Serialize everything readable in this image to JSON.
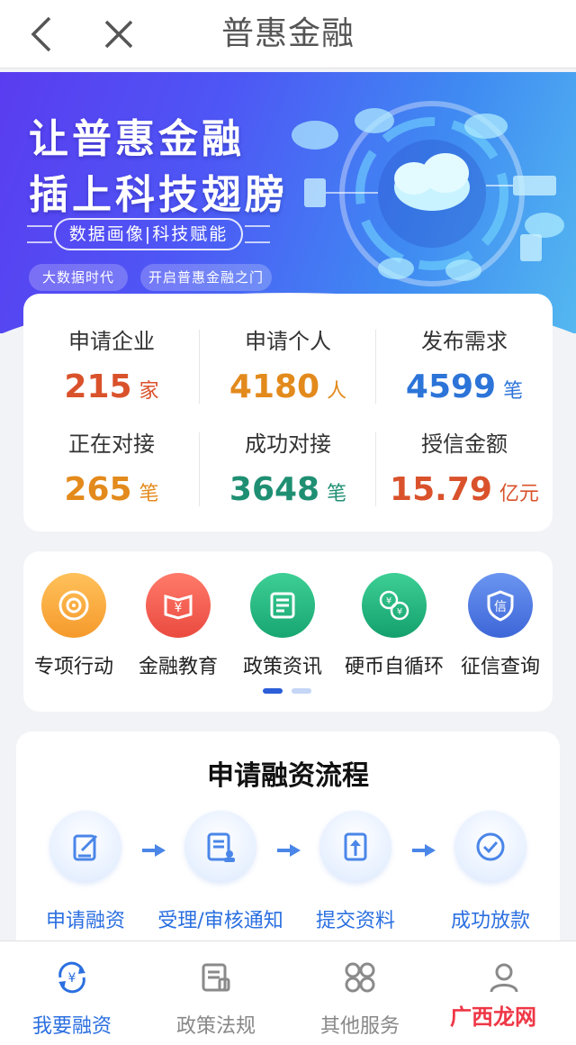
{
  "header": {
    "title": "普惠金融",
    "back_icon": "back-arrow-icon",
    "close_icon": "close-icon"
  },
  "banner": {
    "line1": "让普惠金融",
    "line2": "插上科技翅膀",
    "tagline": "数据画像|科技赋能",
    "pills": [
      "大数据时代",
      "开启普惠金融之门"
    ]
  },
  "stats": [
    {
      "label": "申请企业",
      "value": "215",
      "unit": "家",
      "color": "#d9522b"
    },
    {
      "label": "申请个人",
      "value": "4180",
      "unit": "人",
      "color": "#e38a1c"
    },
    {
      "label": "发布需求",
      "value": "4599",
      "unit": "笔",
      "color": "#2c74d8"
    },
    {
      "label": "正在对接",
      "value": "265",
      "unit": "笔",
      "color": "#e38a1c"
    },
    {
      "label": "成功对接",
      "value": "3648",
      "unit": "笔",
      "color": "#1f8f73"
    },
    {
      "label": "授信金额",
      "value": "15.79",
      "unit": "亿元",
      "color": "#d9522b"
    }
  ],
  "services": [
    {
      "label": "专项行动",
      "icon": "target-icon",
      "color": "#f6a12e"
    },
    {
      "label": "金融教育",
      "icon": "yuan-book-icon",
      "color": "#ef5a4f"
    },
    {
      "label": "政策资讯",
      "icon": "newspaper-icon",
      "color": "#22b27d"
    },
    {
      "label": "硬币自循环",
      "icon": "coin-cycle-icon",
      "color": "#1fae7a"
    },
    {
      "label": "征信查询",
      "icon": "credit-shield-icon",
      "color": "#4b79e4"
    }
  ],
  "process": {
    "title": "申请融资流程",
    "steps": [
      {
        "label": "申请融资",
        "icon": "edit-form-icon"
      },
      {
        "label": "受理/审核通知",
        "icon": "review-doc-icon"
      },
      {
        "label": "提交资料",
        "icon": "upload-doc-icon"
      },
      {
        "label": "成功放款",
        "icon": "check-circle-icon"
      }
    ]
  },
  "nav": [
    {
      "label": "我要融资",
      "icon": "yuan-cycle-icon",
      "active": true
    },
    {
      "label": "政策法规",
      "icon": "document-icon",
      "active": false
    },
    {
      "label": "其他服务",
      "icon": "grid-icon",
      "active": false
    },
    {
      "label": "",
      "icon": "user-icon",
      "active": false
    }
  ],
  "watermark": "广西龙网",
  "colors": {
    "accent": "#2b6fe0",
    "background": "#f2f3f6"
  }
}
